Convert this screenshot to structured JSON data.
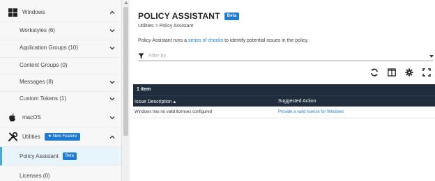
{
  "sidebar": {
    "windows": {
      "label": "Windows"
    },
    "items": [
      {
        "label": "Workstyles (6)"
      },
      {
        "label": "Application Groups (10)"
      },
      {
        "label": "Content Groups (0)"
      },
      {
        "label": "Messages (8)"
      },
      {
        "label": "Custom Tokens (1)"
      }
    ],
    "macos": {
      "label": "macOS"
    },
    "utilities": {
      "label": "Utilities",
      "badge": "New Feature"
    },
    "policy_assistant": {
      "label": "Policy Assistant",
      "badge": "Beta"
    },
    "licenses": {
      "label": "Licenses (0)"
    }
  },
  "main": {
    "title": "POLICY ASSISTANT",
    "title_badge": "Beta",
    "breadcrumb": "Utilities > Policy Assistant",
    "desc_before": "Policy Assistant runs a ",
    "desc_link": "series of checks",
    "desc_after": " to identify potential issues in the policy.",
    "filter_placeholder": "Filter by"
  },
  "grid": {
    "count": "1 item",
    "columns": [
      "Issue Description ▴",
      "Suggested Action"
    ],
    "rows": [
      {
        "issue": "Windows has no valid licenses configured",
        "action": "Provide a valid license for Windows"
      }
    ]
  },
  "icons": {
    "toolbar": [
      "refresh-icon",
      "columns-icon",
      "settings-icon",
      "fullscreen-icon"
    ]
  },
  "colors": {
    "accent": "#1e7bd0",
    "grid_header": "#1f2d3d",
    "active_border": "#4aa8d8"
  }
}
